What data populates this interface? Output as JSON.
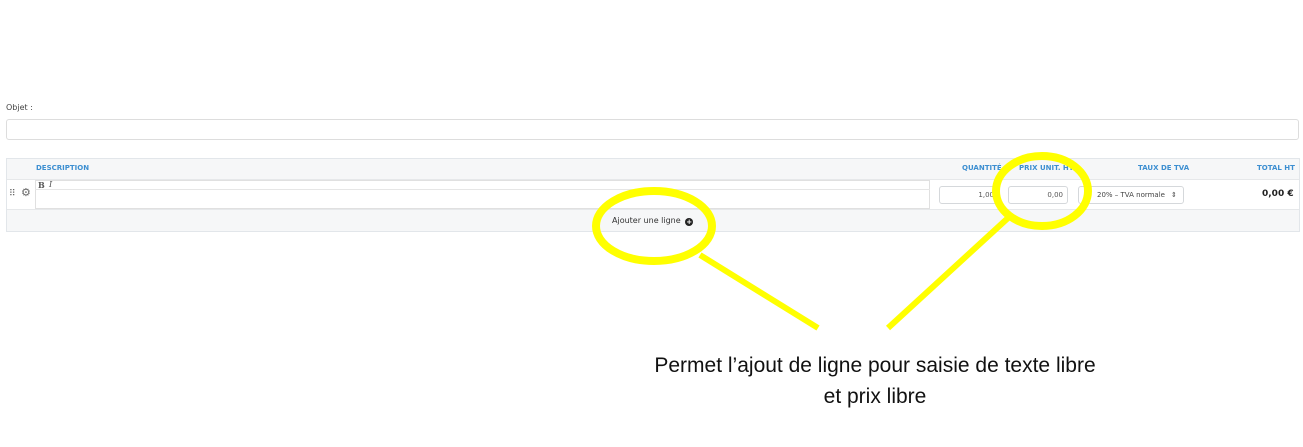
{
  "form": {
    "objet_label": "Objet :",
    "objet_value": ""
  },
  "table": {
    "headers": {
      "description": "DESCRIPTION",
      "quantite": "QUANTITÉ",
      "prix_unit": "PRIX UNIT. HT",
      "taux_tva": "TAUX DE TVA",
      "total": "TOTAL HT"
    },
    "toolbar": {
      "bold": "B",
      "italic": "I"
    },
    "row": {
      "drag_glyph": "⠿",
      "gear_glyph": "⚙",
      "quantite": "1,00",
      "prix_unit": "0,00",
      "tva": "20% – TVA normale",
      "tva_caret": "⇕",
      "total": "0,00 €"
    },
    "add_line_label": "Ajouter une ligne",
    "add_line_icon": "+"
  },
  "annotation": {
    "caption_line1": "Permet l’ajout de ligne pour saisie de texte libre",
    "caption_line2": "et prix libre",
    "highlight_color": "#ffff00"
  },
  "icons": {
    "drag": "drag-handle-icon",
    "gear": "gear-icon",
    "add": "plus-circle-icon"
  }
}
